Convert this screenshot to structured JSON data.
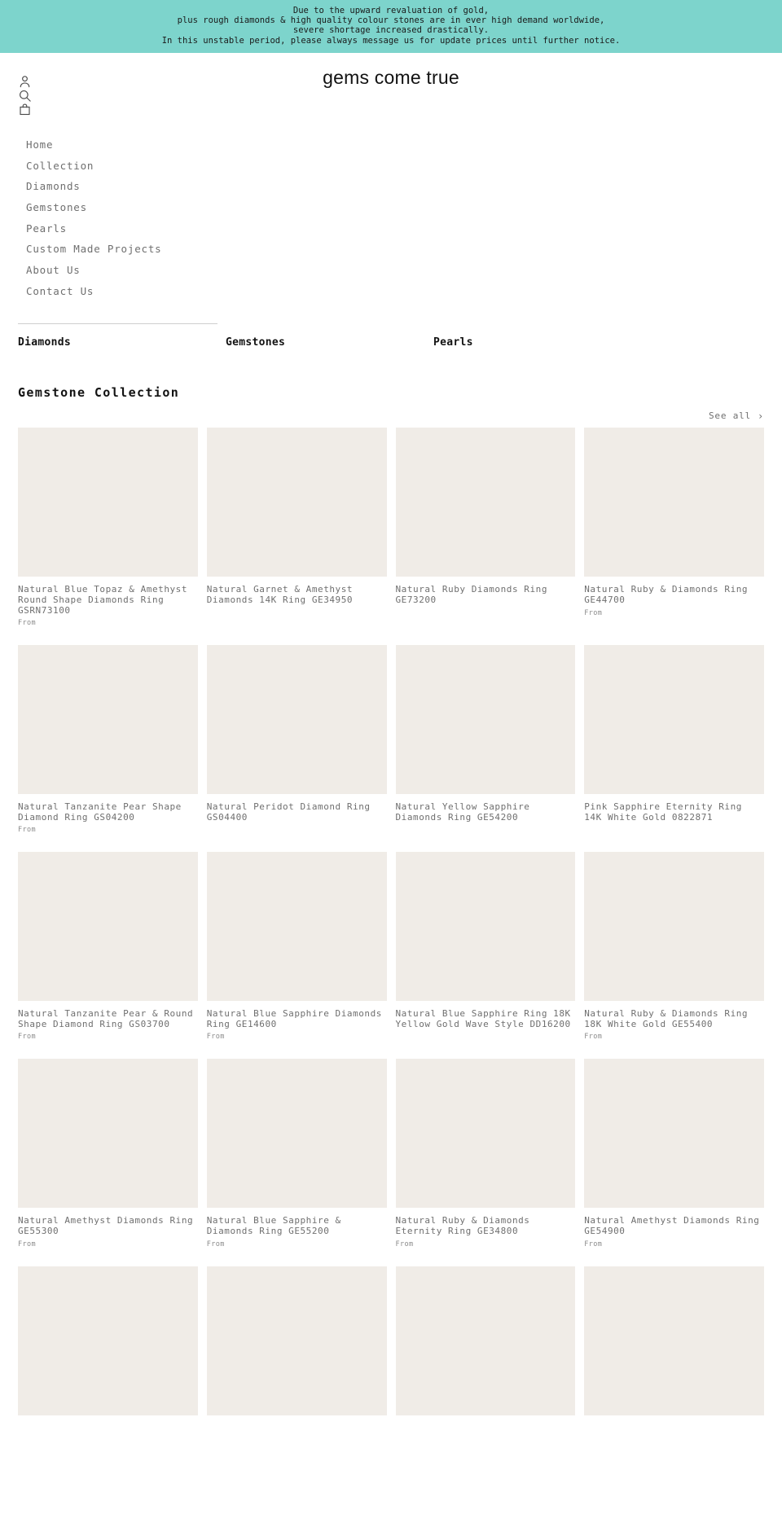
{
  "announcement": {
    "lines": [
      "Due to the upward revaluation of gold,",
      "plus rough diamonds & high quality colour stones are in ever high demand worldwide,",
      "severe shortage increased drastically.",
      "In this unstable period, please always message us for update prices until further notice."
    ],
    "background_color": "#7dd4cc"
  },
  "header": {
    "logo": "gems come true",
    "icons": [
      {
        "name": "account-icon",
        "label": "Account"
      },
      {
        "name": "search-icon",
        "label": "Search"
      },
      {
        "name": "cart-icon",
        "label": "Cart"
      }
    ]
  },
  "nav": {
    "items": [
      {
        "label": "Home"
      },
      {
        "label": "Collection"
      },
      {
        "label": "Diamonds"
      },
      {
        "label": "Gemstones"
      },
      {
        "label": "Pearls"
      },
      {
        "label": "Custom Made Projects"
      },
      {
        "label": "About Us"
      },
      {
        "label": "Contact Us"
      }
    ]
  },
  "category_tabs": [
    {
      "label": "Diamonds",
      "active": true
    },
    {
      "label": "Gemstones",
      "active": false
    },
    {
      "label": "Pearls",
      "active": false
    }
  ],
  "collection": {
    "heading": "Gemstone Collection",
    "see_all_label": "See all",
    "see_all_chevron": "›",
    "products": [
      {
        "title": "Natural Blue Topaz & Amethyst Round Shape Diamonds Ring GSRN73100",
        "price": "From"
      },
      {
        "title": "Natural Garnet & Amethyst Diamonds 14K Ring GE34950",
        "price": ""
      },
      {
        "title": "Natural Ruby Diamonds Ring GE73200",
        "price": ""
      },
      {
        "title": "Natural Ruby & Diamonds Ring GE44700",
        "price": "From"
      },
      {
        "title": "Natural Tanzanite Pear Shape Diamond Ring GS04200",
        "price": "From"
      },
      {
        "title": "Natural Peridot Diamond Ring GS04400",
        "price": ""
      },
      {
        "title": "Natural Yellow Sapphire Diamonds Ring GE54200",
        "price": ""
      },
      {
        "title": "Pink Sapphire Eternity Ring 14K White Gold 0822871",
        "price": ""
      },
      {
        "title": "Natural Tanzanite Pear & Round Shape Diamond Ring GS03700",
        "price": "From"
      },
      {
        "title": "Natural Blue Sapphire Diamonds Ring GE14600",
        "price": "From"
      },
      {
        "title": "Natural Blue Sapphire Ring 18K Yellow Gold Wave Style DD16200",
        "price": ""
      },
      {
        "title": "Natural Ruby & Diamonds Ring 18K White Gold GE55400",
        "price": "From"
      },
      {
        "title": "Natural Amethyst Diamonds Ring GE55300",
        "price": "From"
      },
      {
        "title": "Natural Blue Sapphire & Diamonds Ring GE55200",
        "price": "From"
      },
      {
        "title": "Natural Ruby & Diamonds Eternity Ring GE34800",
        "price": "From"
      },
      {
        "title": "Natural Amethyst Diamonds Ring GE54900",
        "price": "From"
      },
      {
        "title": "",
        "price": ""
      },
      {
        "title": "",
        "price": ""
      },
      {
        "title": "",
        "price": ""
      },
      {
        "title": "",
        "price": ""
      }
    ]
  }
}
